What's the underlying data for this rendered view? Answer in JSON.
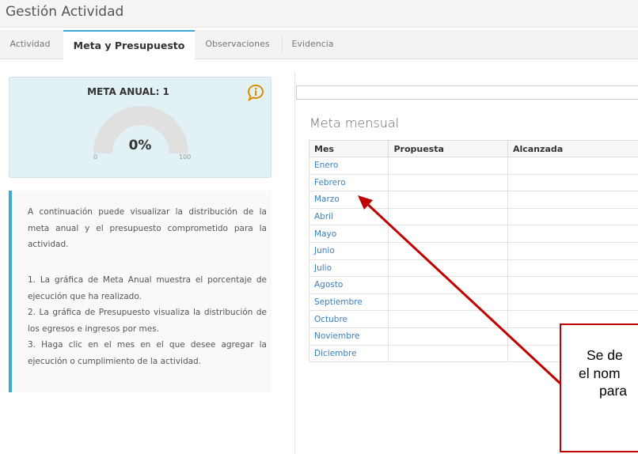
{
  "header": {
    "title": "Gestión Actividad"
  },
  "tabs": [
    {
      "label": "Actividad",
      "active": false
    },
    {
      "label": "Meta y Presupuesto",
      "active": true
    },
    {
      "label": "Observaciones",
      "active": false
    },
    {
      "label": "Evidencia",
      "active": false
    }
  ],
  "meta_card": {
    "title": "META ANUAL: 1",
    "gauge_value": "0%",
    "gauge_percent": 0,
    "gauge_min": "0",
    "gauge_max": "100",
    "info_icon": "info-icon",
    "colors": {
      "background": "#e1f1f4",
      "gauge_track": "#e0e0e0",
      "info_icon": "#e08a00"
    }
  },
  "instructions": {
    "intro": "A continuación puede visualizar la distribución de la meta anual y el presupuesto comprometido para la actividad.",
    "steps": [
      "1. La gráfica de Meta Anual muestra el porcentaje de ejecución que ha realizado.",
      "2. La gráfica de Presupuesto visualiza la distribución de los egresos e ingresos por mes.",
      "3. Haga clic en el mes en el que desee agregar la ejecución o cumplimiento de la actividad."
    ],
    "colors": {
      "accent": "#3fa9d6"
    }
  },
  "monthly": {
    "title": "Meta mensual",
    "columns": [
      "Mes",
      "Propuesta",
      "Alcanzada"
    ],
    "rows": [
      {
        "mes": "Enero",
        "propuesta": "",
        "alcanzada": ""
      },
      {
        "mes": "Febrero",
        "propuesta": "",
        "alcanzada": ""
      },
      {
        "mes": "Marzo",
        "propuesta": "",
        "alcanzada": ""
      },
      {
        "mes": "Abril",
        "propuesta": "",
        "alcanzada": ""
      },
      {
        "mes": "Mayo",
        "propuesta": "",
        "alcanzada": ""
      },
      {
        "mes": "Junio",
        "propuesta": "",
        "alcanzada": ""
      },
      {
        "mes": "Julio",
        "propuesta": "",
        "alcanzada": ""
      },
      {
        "mes": "Agosto",
        "propuesta": "",
        "alcanzada": ""
      },
      {
        "mes": "Septiembre",
        "propuesta": "",
        "alcanzada": ""
      },
      {
        "mes": "Octubre",
        "propuesta": "",
        "alcanzada": ""
      },
      {
        "mes": "Noviembre",
        "propuesta": "",
        "alcanzada": ""
      },
      {
        "mes": "Diciembre",
        "propuesta": "",
        "alcanzada": ""
      }
    ],
    "colors": {
      "link": "#3a7fc1"
    }
  },
  "annotation": {
    "lines": [
      "Se de",
      "el nom",
      "para"
    ],
    "colors": {
      "border": "#c00000",
      "arrow": "#c00000"
    }
  }
}
